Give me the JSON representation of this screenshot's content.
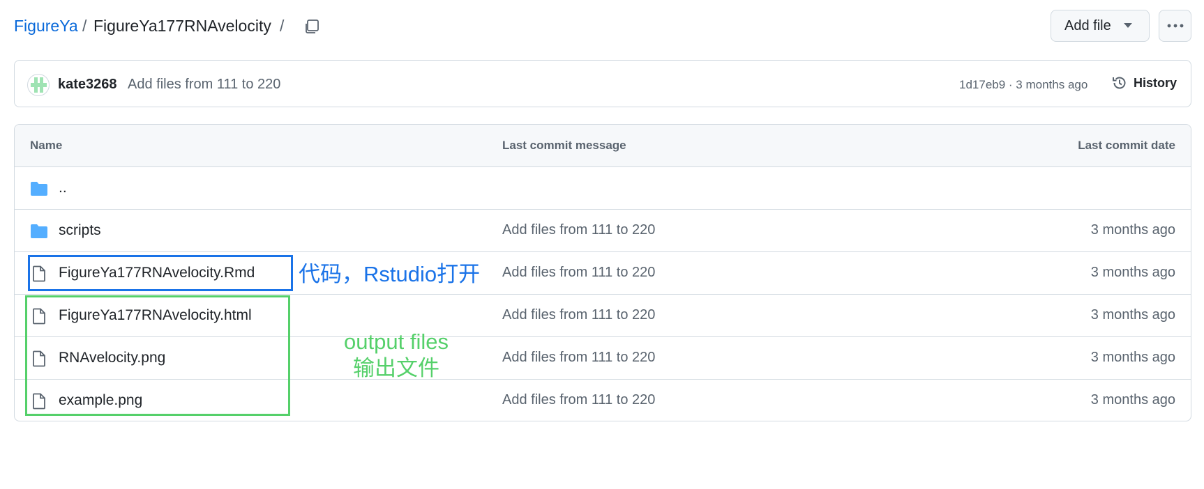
{
  "breadcrumb": {
    "owner": "FigureYa",
    "separator": "/",
    "repo_path": "FigureYa177RNAvelocity"
  },
  "header": {
    "add_file_label": "Add file",
    "icons": {
      "copy": "copy-icon",
      "caret": "triangle-down-icon",
      "more": "kebab-horizontal-icon"
    }
  },
  "commit": {
    "author": "kate3268",
    "message": "Add files from 111 to 220",
    "sha": "1d17eb9",
    "meta_separator": " · ",
    "time": "3 months ago",
    "history_label": "History"
  },
  "table": {
    "headers": {
      "name": "Name",
      "message": "Last commit message",
      "date": "Last commit date"
    },
    "rows": [
      {
        "type": "folder",
        "name": "..",
        "message": "",
        "date": ""
      },
      {
        "type": "folder",
        "name": "scripts",
        "message": "Add files from 111 to 220",
        "date": "3 months ago"
      },
      {
        "type": "file",
        "name": "FigureYa177RNAvelocity.Rmd",
        "message": "Add files from 111 to 220",
        "date": "3 months ago"
      },
      {
        "type": "file",
        "name": "FigureYa177RNAvelocity.html",
        "message": "Add files from 111 to 220",
        "date": "3 months ago"
      },
      {
        "type": "file",
        "name": "RNAvelocity.png",
        "message": "Add files from 111 to 220",
        "date": "3 months ago"
      },
      {
        "type": "file",
        "name": "example.png",
        "message": "Add files from 111 to 220",
        "date": "3 months ago"
      }
    ]
  },
  "annotations": {
    "code": "代码，Rstudio打开",
    "output_line1": "output files",
    "output_line2": "输出文件",
    "colors": {
      "code": "#1a73e8",
      "output": "#55d06a"
    }
  },
  "colors": {
    "link": "#0969da",
    "folder": "#54aeff",
    "muted": "#59636e",
    "border": "#d1d9e0"
  }
}
